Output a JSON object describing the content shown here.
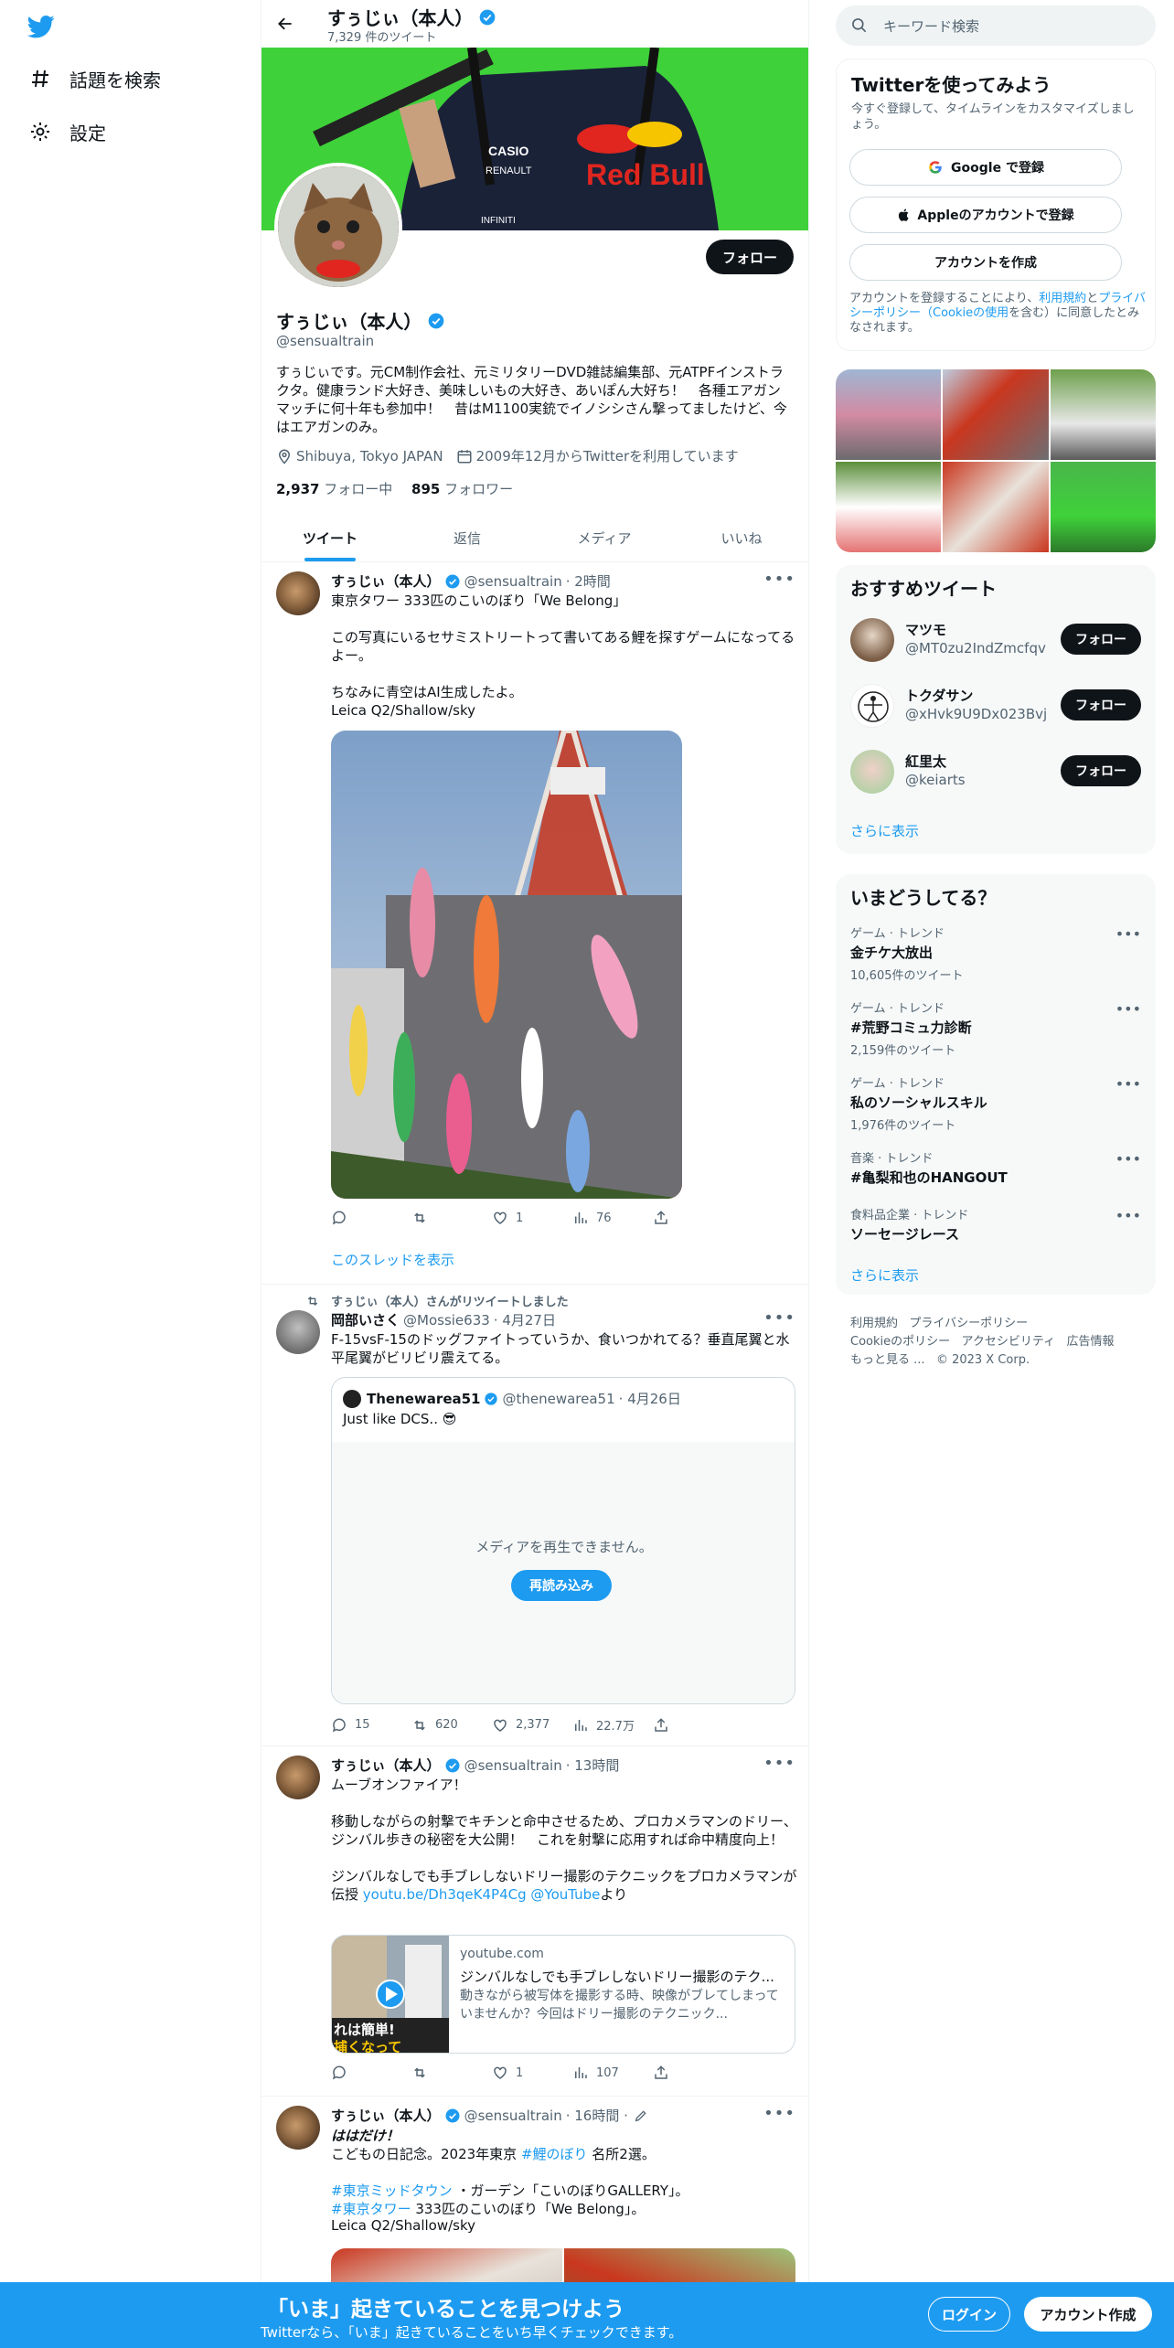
{
  "nav": {
    "explore_label": "話題を検索",
    "settings_label": "設定"
  },
  "profile": {
    "name": "すぅじぃ（本人）",
    "tweet_count": "7,329 件のツイート",
    "handle": "@sensualtrain",
    "bio": "すぅじぃです。元CM制作会社、元ミリタリーDVD雑誌編集部、元ATPFインストラクタ。健康ランド大好き、美味しいもの大好き、あいぽん大好ち！　各種エアガンマッチに何十年も参加中！　昔はM1100実銃でイノシシさん撃ってましたけど、今はエアガンのみ。",
    "location": "Shibuya, Tokyo JAPAN",
    "joined": "2009年12月からTwitterを利用しています",
    "following_count": "2,937",
    "following_label": "フォロー中",
    "followers_count": "895",
    "followers_label": "フォロワー",
    "follow_button": "フォロー"
  },
  "tabs": [
    "ツイート",
    "返信",
    "メディア",
    "いいね"
  ],
  "tweets": [
    {
      "name": "すぅじぃ（本人）",
      "handle": "@sensualtrain",
      "time": "· 2時間",
      "text": "東京タワー 333匹のこいのぼり「We Belong」\n\nこの写真にいるセサミストリートって書いてある鯉を探すゲームになってるよー。\n\nちなみに青空はAI生成したよ。\nLeica Q2/Shallow/sky",
      "reply": "",
      "retweet": "",
      "like": "1",
      "views": "76",
      "thread_link": "このスレッドを表示"
    },
    {
      "retweeted_by": "すぅじぃ（本人）さんがリツイートしました",
      "name": "岡部いさく",
      "handle": "@Mossie633",
      "time": "· 4月27日",
      "text": "F-15vsF-15のドッグファイトっていうか、食いつかれてる？垂直尾翼と水平尾翼がビリビリ震えてる。",
      "quote": {
        "name": "Thenewarea51",
        "handle": "@thenewarea51",
        "time": "· 4月26日",
        "text": "Just like DCS.. 😎",
        "media_error": "メディアを再生できません。",
        "reload": "再読み込み"
      },
      "reply": "15",
      "retweet": "620",
      "like": "2,377",
      "views": "22.7万"
    },
    {
      "name": "すぅじぃ（本人）",
      "handle": "@sensualtrain",
      "time": "· 13時間",
      "text_1": "ムーブオンファイア！\n\n移動しながらの射撃でキチンと命中させるため、プロカメラマンのドリー、ジンバル歩きの秘密を大公開！　これを射撃に応用すれば命中精度向上！\n\nジンバルなしでも手ブレしないドリー撮影のテクニックをプロカメラマンが伝授 ",
      "link_1": "youtu.be/Dh3qeK4P4Cg",
      "link_2": "@YouTube",
      "text_2": "より",
      "card": {
        "domain": "youtube.com",
        "title": "ジンバルなしでも手ブレしないドリー撮影のテク...",
        "desc": "動きながら被写体を撮影する時、映像がブレてしまっていませんか？今回はドリー撮影のテクニック...",
        "thumb_text_1": "れは簡単!",
        "thumb_text_2": "捕くなって"
      },
      "reply": "",
      "retweet": "",
      "like": "1",
      "views": "107"
    },
    {
      "name": "すぅじぃ（本人）",
      "handle": "@sensualtrain",
      "time": "· 16時間 ·",
      "line1": "ははだけ！",
      "line2a": "こどもの日記念。2023年東京 ",
      "hashtag1": "#鯉のぼり",
      "line2b": " 名所2選。",
      "hashtag2": "#東京ミッドタウン",
      "line3b": " ・ガーデン「こいのぼりGALLERY」。",
      "hashtag3": "#東京タワー",
      "line4b": " 333匹のこいのぼり「We Belong」。",
      "line5": "Leica Q2/Shallow/sky"
    }
  ],
  "right": {
    "search_placeholder": "キーワード検索",
    "join": {
      "title": "Twitterを使ってみよう",
      "subtitle": "今すぐ登録して、タイムラインをカスタマイズしましょう。",
      "google": "Google で登録",
      "apple": "Appleのアカウントで登録",
      "create": "アカウントを作成",
      "legal_1": "アカウントを登録することにより、",
      "legal_link_1": "利用規約",
      "legal_2": "と",
      "legal_link_2": "プライバシーポリシー（Cookieの使用",
      "legal_3": "を含む）に同意したとみなされます。"
    },
    "recommended": {
      "title": "おすすめツイート",
      "users": [
        {
          "name": "マツモ",
          "handle": "@MT0zu2IndZmcfqv",
          "button": "フォロー"
        },
        {
          "name": "トクダサン",
          "handle": "@xHvk9U9Dx023Bvj",
          "button": "フォロー"
        },
        {
          "name": "紅里太",
          "handle": "@keiarts",
          "button": "フォロー"
        }
      ],
      "show_more": "さらに表示"
    },
    "trends": {
      "title": "いまどうしてる？",
      "items": [
        {
          "category": "ゲーム · トレンド",
          "title": "金チケ大放出",
          "count": "10,605件のツイート"
        },
        {
          "category": "ゲーム · トレンド",
          "title": "#荒野コミュ力診断",
          "count": "2,159件のツイート"
        },
        {
          "category": "ゲーム · トレンド",
          "title": "私のソーシャルスキル",
          "count": "1,976件のツイート"
        },
        {
          "category": "音楽 · トレンド",
          "title": "#亀梨和也のHANGOUT",
          "count": ""
        },
        {
          "category": "食料品企業 · トレンド",
          "title": "ソーセージレース",
          "count": ""
        }
      ],
      "show_more": "さらに表示"
    },
    "footer": {
      "l1": "利用規約",
      "l2": "プライバシーポリシー",
      "l3": "Cookieのポリシー",
      "l4": "アクセシビリティ",
      "l5": "広告情報",
      "l6": "もっと見る ...",
      "copyright": "© 2023 X Corp."
    }
  },
  "bottom": {
    "title": "「いま」起きていることを見つけよう",
    "subtitle": "Twitterなら、「いま」起きていることをいち早くチェックできます。",
    "login": "ログイン",
    "signup": "アカウント作成"
  },
  "banner_texts": [
    "CASIO",
    "RENAULT",
    "Red Bull",
    "INFINITI"
  ],
  "colors": {
    "accent": "#1d9bf0",
    "text": "#0f1419",
    "muted": "#536471",
    "banner_green": "#3fd13a"
  }
}
